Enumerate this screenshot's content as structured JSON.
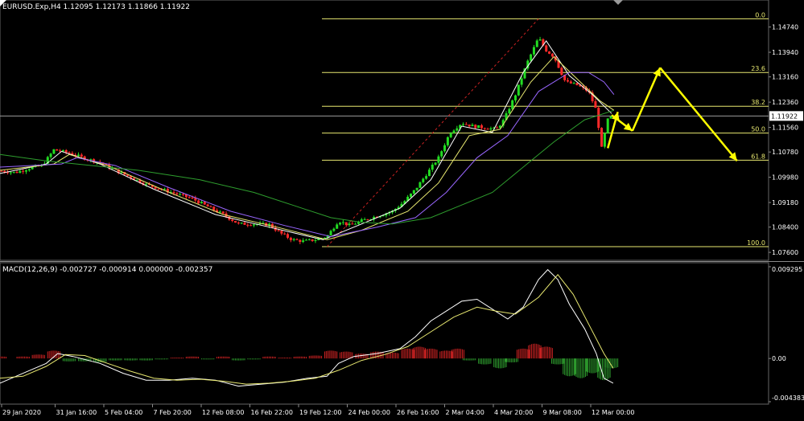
{
  "header": {
    "symbol_info": "EURUSD.Exp,H4  1.12095 1.12173 1.11866 1.11922",
    "indicator_info": "MACD(12,26,9) -0.002727 -0.000914 0.000000 -0.002357"
  },
  "colors": {
    "background": "#000000",
    "bull_candle": "#22dd22",
    "bear_candle": "#ff2a2a",
    "fib_lines": "#e8e870",
    "ma_white": "#ffffff",
    "ma_yellow": "#e8e870",
    "ma_purple": "#9966ff",
    "ma_green": "#2e9e2e",
    "arrows": "#ffff00",
    "trend_dashed": "#cc2222",
    "price_line": "#9a9a9a",
    "macd_hist_pos": "#cc2222",
    "macd_hist_neg": "#2e9e2e",
    "macd_line": "#ffffff",
    "signal_line": "#e8e870"
  },
  "chart_data": [
    {
      "type": "candlestick",
      "title": "EURUSD.Exp,H4",
      "ohlc_last": {
        "open": 1.12095,
        "high": 1.12173,
        "low": 1.11866,
        "close": 1.11922
      },
      "current_price_label": "1.11922",
      "ylim": [
        1.0745,
        1.1524
      ],
      "y_ticks": [
        "1.14740",
        "1.13940",
        "1.13160",
        "1.12360",
        "1.11560",
        "1.10780",
        "1.09980",
        "1.09180",
        "1.08400",
        "1.07600"
      ],
      "x_ticks": [
        "29 Jan 2020",
        "31 Jan 16:00",
        "5 Feb 04:00",
        "7 Feb 20:00",
        "12 Feb 08:00",
        "16 Feb 22:00",
        "19 Feb 12:00",
        "24 Feb 00:00",
        "26 Feb 16:00",
        "2 Mar 04:00",
        "4 Mar 20:00",
        "9 Mar 08:00",
        "12 Mar 00:00"
      ],
      "price_path": [
        [
          0,
          1.1018
        ],
        [
          20,
          1.1013
        ],
        [
          40,
          1.1028
        ],
        [
          55,
          1.1035
        ],
        [
          70,
          1.1085
        ],
        [
          90,
          1.1075
        ],
        [
          110,
          1.1058
        ],
        [
          130,
          1.1045
        ],
        [
          150,
          1.102
        ],
        [
          170,
          1.0998
        ],
        [
          190,
          1.0975
        ],
        [
          210,
          1.096
        ],
        [
          230,
          1.0945
        ],
        [
          250,
          1.093
        ],
        [
          270,
          1.0905
        ],
        [
          290,
          1.088
        ],
        [
          310,
          1.085
        ],
        [
          330,
          1.085
        ],
        [
          350,
          1.0848
        ],
        [
          365,
          1.082
        ],
        [
          380,
          1.08
        ],
        [
          395,
          1.0795
        ],
        [
          410,
          1.08
        ],
        [
          425,
          1.081
        ],
        [
          440,
          1.086
        ],
        [
          455,
          1.0845
        ],
        [
          470,
          1.086
        ],
        [
          490,
          1.0875
        ],
        [
          510,
          1.089
        ],
        [
          525,
          1.092
        ],
        [
          540,
          1.096
        ],
        [
          555,
          1.101
        ],
        [
          570,
          1.106
        ],
        [
          585,
          1.114
        ],
        [
          600,
          1.117
        ],
        [
          615,
          1.116
        ],
        [
          630,
          1.1155
        ],
        [
          645,
          1.115
        ],
        [
          655,
          1.118
        ],
        [
          670,
          1.126
        ],
        [
          685,
          1.136
        ],
        [
          700,
          1.144
        ],
        [
          710,
          1.14
        ],
        [
          720,
          1.138
        ],
        [
          735,
          1.13
        ],
        [
          750,
          1.129
        ],
        [
          765,
          1.127
        ],
        [
          775,
          1.121
        ],
        [
          782,
          1.109
        ],
        [
          790,
          1.118
        ],
        [
          796,
          1.1192
        ]
      ],
      "moving_averages": [
        {
          "color_key": "ma_white",
          "path": [
            [
              0,
              1.101
            ],
            [
              60,
              1.104
            ],
            [
              80,
              1.108
            ],
            [
              130,
              1.104
            ],
            [
              200,
              1.096
            ],
            [
              280,
              1.088
            ],
            [
              350,
              1.084
            ],
            [
              420,
              1.08
            ],
            [
              460,
              1.084
            ],
            [
              520,
              1.09
            ],
            [
              560,
              1.099
            ],
            [
              600,
              1.116
            ],
            [
              640,
              1.114
            ],
            [
              680,
              1.133
            ],
            [
              710,
              1.143
            ],
            [
              740,
              1.132
            ],
            [
              770,
              1.126
            ],
            [
              795,
              1.12
            ]
          ]
        },
        {
          "color_key": "ma_yellow",
          "path": [
            [
              0,
              1.102
            ],
            [
              70,
              1.104
            ],
            [
              90,
              1.107
            ],
            [
              140,
              1.1035
            ],
            [
              210,
              1.096
            ],
            [
              290,
              1.088
            ],
            [
              360,
              1.084
            ],
            [
              425,
              1.08
            ],
            [
              470,
              1.083
            ],
            [
              530,
              1.089
            ],
            [
              570,
              1.098
            ],
            [
              610,
              1.113
            ],
            [
              650,
              1.115
            ],
            [
              690,
              1.13
            ],
            [
              720,
              1.138
            ],
            [
              750,
              1.131
            ],
            [
              780,
              1.124
            ],
            [
              798,
              1.121
            ]
          ]
        },
        {
          "color_key": "ma_purple",
          "path": [
            [
              0,
              1.103
            ],
            [
              80,
              1.104
            ],
            [
              100,
              1.106
            ],
            [
              150,
              1.1035
            ],
            [
              220,
              1.0965
            ],
            [
              300,
              1.089
            ],
            [
              370,
              1.0845
            ],
            [
              430,
              1.081
            ],
            [
              490,
              1.084
            ],
            [
              540,
              1.087
            ],
            [
              580,
              1.095
            ],
            [
              620,
              1.106
            ],
            [
              660,
              1.113
            ],
            [
              700,
              1.127
            ],
            [
              740,
              1.133
            ],
            [
              765,
              1.133
            ],
            [
              785,
              1.13
            ],
            [
              798,
              1.126
            ]
          ]
        },
        {
          "color_key": "ma_green",
          "path": [
            [
              0,
              1.107
            ],
            [
              60,
              1.105
            ],
            [
              120,
              1.1035
            ],
            [
              180,
              1.102
            ],
            [
              260,
              1.099
            ],
            [
              330,
              1.095
            ],
            [
              380,
              1.091
            ],
            [
              430,
              1.087
            ],
            [
              470,
              1.0855
            ],
            [
              510,
              1.085
            ],
            [
              560,
              1.087
            ],
            [
              600,
              1.091
            ],
            [
              640,
              1.095
            ],
            [
              680,
              1.103
            ],
            [
              720,
              1.111
            ],
            [
              760,
              1.118
            ],
            [
              798,
              1.121
            ]
          ]
        }
      ],
      "fibonacci": [
        {
          "label": "0.0",
          "price": 1.15
        },
        {
          "label": "23.6",
          "price": 1.133
        },
        {
          "label": "38.2",
          "price": 1.1223
        },
        {
          "label": "50.0",
          "price": 1.1138
        },
        {
          "label": "61.8",
          "price": 1.1052
        },
        {
          "label": "100.0",
          "price": 1.0778
        }
      ],
      "projection_arrows": [
        [
          [
            790,
            1.109
          ],
          [
            803,
            1.1205
          ]
        ],
        [
          [
            795,
            1.1195
          ],
          [
            822,
            1.1145
          ]
        ],
        [
          [
            822,
            1.1145
          ],
          [
            858,
            1.1345
          ]
        ],
        [
          [
            858,
            1.1345
          ],
          [
            958,
            1.105
          ]
        ]
      ]
    },
    {
      "type": "line",
      "title": "MACD(12,26,9)",
      "ylim": [
        -0.004383,
        0.009295
      ],
      "y_ticks": [
        "0.009295",
        "0.00",
        "-0.004383"
      ],
      "macd_line": [
        [
          0,
          -0.0025
        ],
        [
          30,
          -0.0015
        ],
        [
          60,
          -0.0005
        ],
        [
          75,
          0.0005
        ],
        [
          95,
          0.0002
        ],
        [
          130,
          -0.0005
        ],
        [
          160,
          -0.0015
        ],
        [
          190,
          -0.0022
        ],
        [
          220,
          -0.0022
        ],
        [
          250,
          -0.002
        ],
        [
          280,
          -0.0022
        ],
        [
          310,
          -0.0028
        ],
        [
          340,
          -0.0026
        ],
        [
          370,
          -0.0024
        ],
        [
          400,
          -0.002
        ],
        [
          425,
          -0.0018
        ],
        [
          440,
          -0.0005
        ],
        [
          460,
          0.0002
        ],
        [
          490,
          0.0005
        ],
        [
          520,
          0.001
        ],
        [
          540,
          0.0022
        ],
        [
          560,
          0.0038
        ],
        [
          580,
          0.0048
        ],
        [
          600,
          0.0058
        ],
        [
          620,
          0.006
        ],
        [
          640,
          0.005
        ],
        [
          660,
          0.004
        ],
        [
          680,
          0.0052
        ],
        [
          700,
          0.008
        ],
        [
          712,
          0.009
        ],
        [
          725,
          0.008
        ],
        [
          740,
          0.0055
        ],
        [
          760,
          0.003
        ],
        [
          775,
          0.0005
        ],
        [
          785,
          -0.002
        ],
        [
          797,
          -0.0025
        ]
      ],
      "signal_line": [
        [
          0,
          -0.002
        ],
        [
          30,
          -0.0018
        ],
        [
          60,
          -0.0008
        ],
        [
          85,
          0.0004
        ],
        [
          110,
          0.0003
        ],
        [
          140,
          -0.0005
        ],
        [
          170,
          -0.0013
        ],
        [
          200,
          -0.002
        ],
        [
          230,
          -0.0022
        ],
        [
          260,
          -0.0021
        ],
        [
          290,
          -0.0023
        ],
        [
          320,
          -0.0026
        ],
        [
          350,
          -0.0025
        ],
        [
          380,
          -0.0023
        ],
        [
          410,
          -0.002
        ],
        [
          440,
          -0.0012
        ],
        [
          470,
          -0.0002
        ],
        [
          500,
          0.0004
        ],
        [
          530,
          0.0012
        ],
        [
          560,
          0.0027
        ],
        [
          590,
          0.0042
        ],
        [
          620,
          0.0052
        ],
        [
          645,
          0.0048
        ],
        [
          670,
          0.0045
        ],
        [
          700,
          0.0062
        ],
        [
          725,
          0.0085
        ],
        [
          745,
          0.0065
        ],
        [
          765,
          0.0035
        ],
        [
          785,
          0.0005
        ],
        [
          797,
          -0.001
        ]
      ],
      "histogram": [
        [
          0,
          0.0002
        ],
        [
          30,
          0.0002
        ],
        [
          50,
          0.0004
        ],
        [
          70,
          0.0008
        ],
        [
          90,
          -0.0003
        ],
        [
          110,
          -0.0003
        ],
        [
          130,
          -0.0004
        ],
        [
          150,
          -0.0002
        ],
        [
          170,
          -0.0002
        ],
        [
          190,
          -0.0002
        ],
        [
          210,
          -0.0001
        ],
        [
          230,
          0.0001
        ],
        [
          250,
          0.0002
        ],
        [
          270,
          -0.0001
        ],
        [
          290,
          0.0002
        ],
        [
          310,
          -0.0002
        ],
        [
          330,
          -0.0001
        ],
        [
          350,
          0.0002
        ],
        [
          370,
          0.0001
        ],
        [
          390,
          0.0002
        ],
        [
          410,
          0.0003
        ],
        [
          430,
          0.0008
        ],
        [
          450,
          0.0007
        ],
        [
          470,
          0.0005
        ],
        [
          490,
          0.0007
        ],
        [
          510,
          0.0006
        ],
        [
          530,
          0.001
        ],
        [
          545,
          0.0012
        ],
        [
          560,
          0.001
        ],
        [
          580,
          0.0008
        ],
        [
          595,
          0.001
        ],
        [
          610,
          -0.0002
        ],
        [
          630,
          -0.0006
        ],
        [
          650,
          -0.001
        ],
        [
          665,
          -0.0004
        ],
        [
          680,
          0.001
        ],
        [
          695,
          0.0015
        ],
        [
          710,
          0.0012
        ],
        [
          725,
          -0.0006
        ],
        [
          740,
          -0.0018
        ],
        [
          755,
          -0.002
        ],
        [
          770,
          -0.0015
        ],
        [
          785,
          -0.0022
        ],
        [
          795,
          -0.001
        ]
      ]
    }
  ]
}
